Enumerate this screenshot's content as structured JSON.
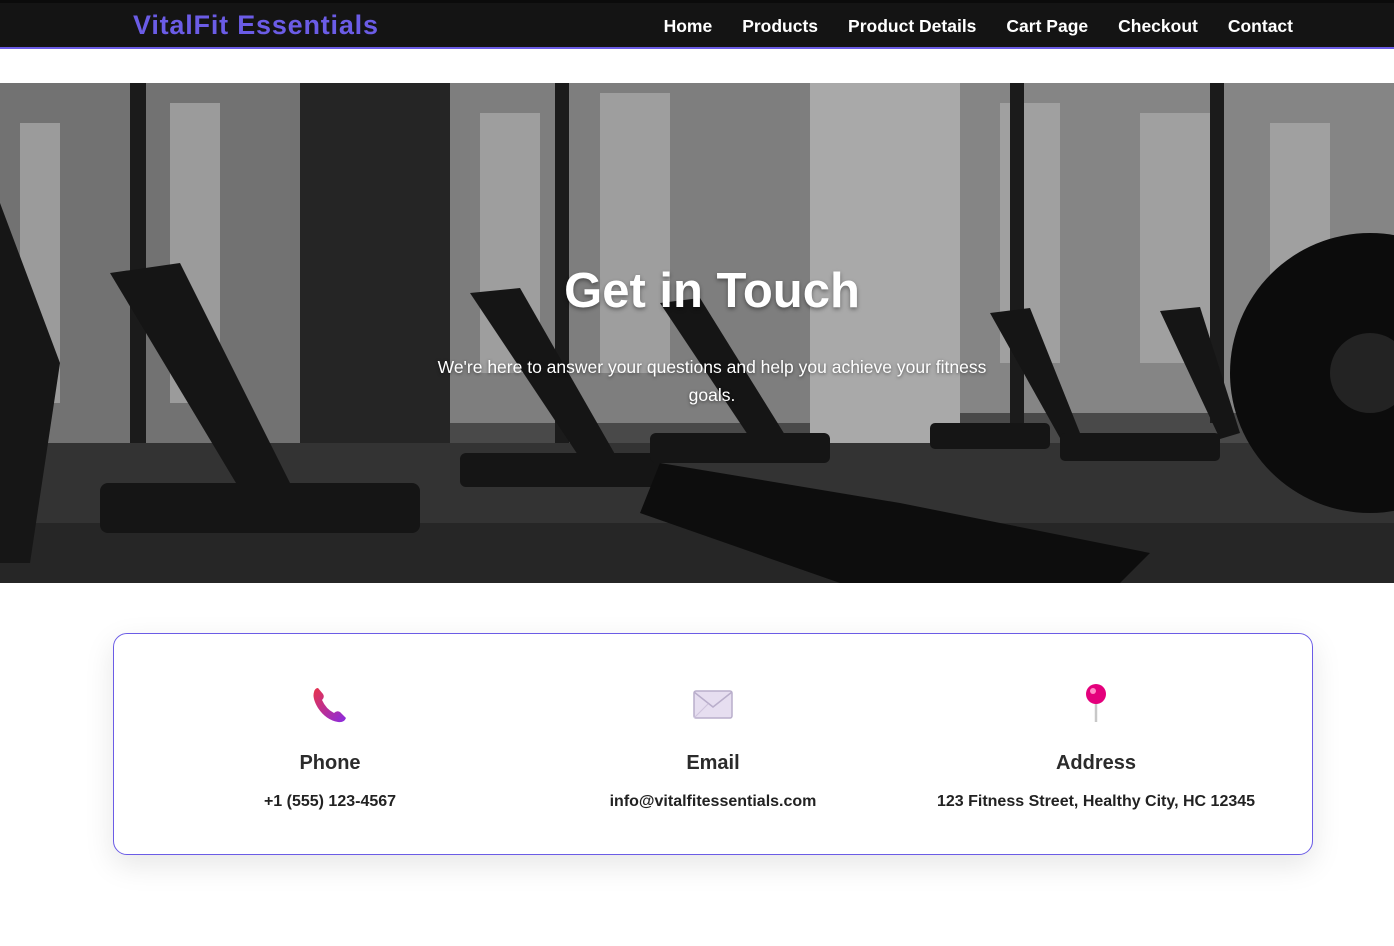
{
  "header": {
    "brand": "VitalFit Essentials",
    "nav": [
      "Home",
      "Products",
      "Product Details",
      "Cart Page",
      "Checkout",
      "Contact"
    ]
  },
  "hero": {
    "title": "Get in Touch",
    "subtitle": "We're here to answer your questions and help you achieve your fitness goals."
  },
  "contact": {
    "items": [
      {
        "icon": "phone-icon",
        "title": "Phone",
        "value": "+1 (555) 123-4567"
      },
      {
        "icon": "envelope-icon",
        "title": "Email",
        "value": "info@vitalfitessentials.com"
      },
      {
        "icon": "pushpin-icon",
        "title": "Address",
        "value": "123 Fitness Street, Healthy City, HC 12345"
      }
    ]
  },
  "colors": {
    "accent": "#6b5ce6",
    "nav_bg": "#141414",
    "pin": "#e4007c",
    "phone": "#e8334a"
  }
}
